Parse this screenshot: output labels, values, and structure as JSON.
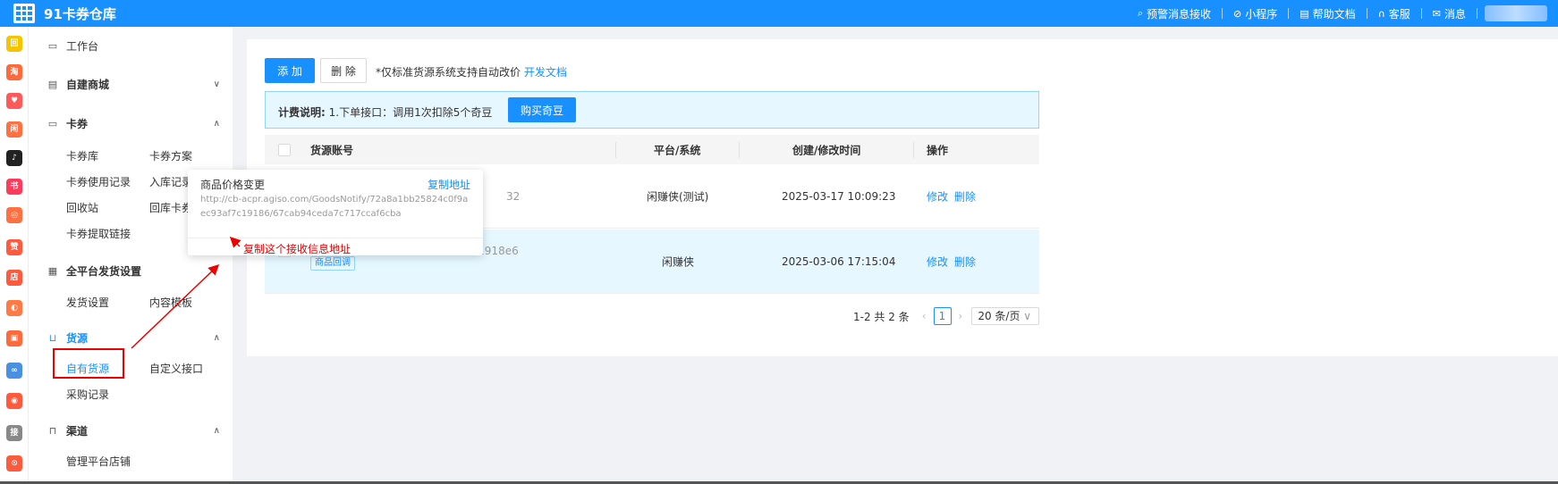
{
  "topbar": {
    "app_title": "91卡券仓库",
    "items": [
      {
        "icon": "search-icon",
        "glyph": "⌕",
        "label": "预警消息接收"
      },
      {
        "icon": "mini-program-icon",
        "glyph": "⊘",
        "label": "小程序"
      },
      {
        "icon": "doc-icon",
        "glyph": "▤",
        "label": "帮助文档"
      },
      {
        "icon": "headset-icon",
        "glyph": "∩",
        "label": "客服"
      },
      {
        "icon": "mail-icon",
        "glyph": "✉",
        "label": "消息"
      }
    ]
  },
  "rail": {
    "icons": [
      {
        "name": "rail-icon-1",
        "text": "回",
        "color": "#f5c400"
      },
      {
        "name": "rail-icon-2",
        "text": "淘",
        "color": "#ff6a3d"
      },
      {
        "name": "rail-icon-3",
        "text": "♥",
        "color": "#ff5a5a"
      },
      {
        "name": "rail-icon-4",
        "text": "闲",
        "color": "#ff7043"
      },
      {
        "name": "rail-icon-5",
        "text": "♪",
        "color": "#222222"
      },
      {
        "name": "rail-icon-6",
        "text": "书",
        "color": "#ff3b5c"
      },
      {
        "name": "rail-icon-7",
        "text": "◎",
        "color": "#ff7043"
      },
      {
        "name": "rail-icon-8",
        "text": "赞",
        "color": "#ff5a3d"
      },
      {
        "name": "rail-icon-9",
        "text": "店",
        "color": "#ff5a3d"
      },
      {
        "name": "rail-icon-10",
        "text": "◐",
        "color": "#ff7a45"
      },
      {
        "name": "rail-icon-11",
        "text": "▣",
        "color": "#ff6a3d"
      },
      {
        "name": "rail-icon-12",
        "text": "∞",
        "color": "#4a90e2"
      },
      {
        "name": "rail-icon-13",
        "text": "◉",
        "color": "#ff5a3d"
      },
      {
        "name": "rail-icon-14",
        "text": "接",
        "color": "#888888"
      },
      {
        "name": "rail-icon-15",
        "text": "⊙",
        "color": "#ff5a3d"
      }
    ]
  },
  "sidebar": {
    "workbench": "工作台",
    "mall": "自建商城",
    "coupons": "卡券",
    "coupon_items": [
      "卡券库",
      "卡券方案",
      "卡券使用记录",
      "入库记录",
      "回收站",
      "回库卡券",
      "卡券提取链接"
    ],
    "delivery": "全平台发货设置",
    "delivery_items": [
      "发货设置",
      "内容模板"
    ],
    "supply": "货源",
    "supply_items": [
      "自有货源",
      "自定义接口",
      "采购记录"
    ],
    "channel": "渠道",
    "channel_items": [
      "管理平台店铺"
    ]
  },
  "toolbar": {
    "add": "添 加",
    "delete": "删 除",
    "note": "*仅标准货源系统支持自动改价",
    "dev_doc": "开发文档"
  },
  "billing": {
    "label": "计费说明:",
    "text": "1.下单接口：调用1次扣除5个奇豆",
    "buy": "购买奇豆"
  },
  "table": {
    "headers": [
      "货源账号",
      "平台/系统",
      "创建/修改时间",
      "操作"
    ],
    "rows": [
      {
        "account_tail": "32",
        "platform": "闲赚侠(测试)",
        "time": "2025-03-17 10:09:23",
        "edit": "修改",
        "delete": "删除"
      },
      {
        "account": "72a8a1bb25824c0f9aec93af7c1918e6",
        "tag": "商品回调",
        "platform": "闲赚侠",
        "time": "2025-03-06 17:15:04",
        "edit": "修改",
        "delete": "删除"
      }
    ]
  },
  "pager": {
    "summary": "1-2 共 2 条",
    "page": "1",
    "size": "20 条/页"
  },
  "popover": {
    "title": "商品价格变更",
    "copy": "复制地址",
    "url": "http://cb-acpr.agiso.com/GoodsNotify/72a8a1bb25824c0f9aec93af7c19186/67cab94ceda7c717ccaf6cba"
  },
  "annotation": "复制这个接收信息地址"
}
